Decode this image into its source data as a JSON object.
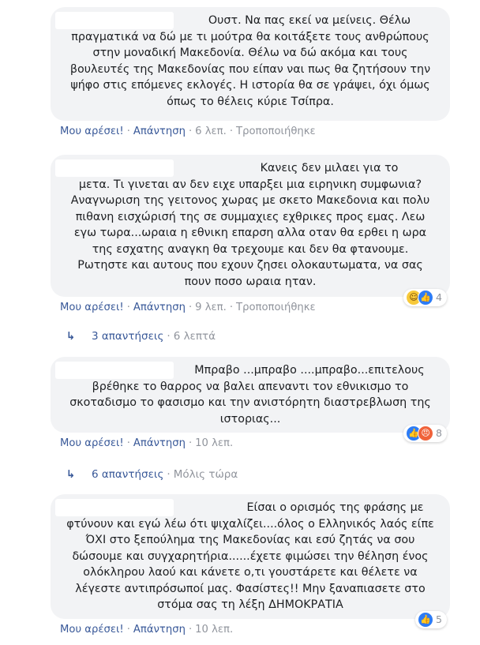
{
  "comments": [
    {
      "lines": [
        "Ουστ. Να πας εκεί να μείνεις. Θέλω",
        "πραγματικά να δώ με τι μούτρα θα κοιτάξετε τους ανθρώπους",
        "στην μοναδική Μακεδονία. Θέλω να δώ ακόμα και τους",
        "βουλευτές της Μακεδονίας που είπαν ναι πως θα ζητήσουν την",
        "ψήφο στις επόμενες εκλογές. Η ιστορία θα σε γράψει, όχι όμως",
        "όπως το θέλεις κύριε Τσίπρα."
      ],
      "like": "Μου αρέσει!",
      "reply": "Απάντηση",
      "time": "6 λεπ.",
      "edited": "Τροποποιήθηκε"
    },
    {
      "lines": [
        "Κανεις δεν μιλαει για το",
        "μετα. Τι γινεται αν δεν ειχε υπαρξει μια ειρηνικη συμφωνια?",
        "Αναγνωριση της γειτονος χωρας με σκετο Μακεδονια και πολυ",
        "πιθανη εισχώρισή της σε συμμαχιες εχθρικες προς εμας. Λεω",
        "εγω τωρα...ωραια η εθνικη επαρση αλλα οταν θα ερθει η ωρα",
        "της εσχατης αναγκη θα τρεχουμε και δεν θα φτανουμε.",
        "Ρωτηστε και αυτους που εχουν ζησει ολοκαυτωματα, να σας",
        "πουν ποσο ωραια ηταν."
      ],
      "like": "Μου αρέσει!",
      "reply": "Απάντηση",
      "time": "9 λεπ.",
      "edited": "Τροποποιήθηκε",
      "reaction_count": "4",
      "reaction_icons": [
        "haha-icon",
        "like-icon"
      ]
    },
    {
      "lines": [
        "Μπραβο ...μπραβο ....μπραβο...επιτελους",
        "βρέθηκε το θαρρος να βαλει απεναντι τον εθνικισμο το",
        "σκοταδισμο το φασισμο και την ανιστόρητη διαστρεβλωση της",
        "ιστοριας..."
      ],
      "like": "Μου αρέσει!",
      "reply": "Απάντηση",
      "time": "10 λεπ.",
      "reaction_count": "8",
      "reaction_icons": [
        "like-icon",
        "angry-icon"
      ]
    },
    {
      "lines": [
        "Είσαι ο ορισμός της φράσης με",
        "φτύνουν και εγώ λέω ότι ψιχαλίζει....όλος ο Ελληνικός λαός είπε",
        "ΌΧΙ στο ξεπούλημα της Μακεδονίας και εσύ ζητάς να σου",
        "δώσουμε και συγχαρητήρια......έχετε φιμώσει την θέληση ένος",
        "ολόκληρου λαού και κάνετε ο,τι γουστάρετε και θέλετε να",
        "λέγεστε αντιπρόσωποί μας. Φασίστες!! Μην ξαναπιασετε στο",
        "στόμα σας τη λέξη ΔΗΜΟΚΡΑΤΙΑ"
      ],
      "like": "Μου αρέσει!",
      "reply": "Απάντηση",
      "time": "10 λεπ.",
      "reaction_count": "5",
      "reaction_icons": [
        "like-icon"
      ]
    }
  ],
  "reply_threads": [
    {
      "label": "3 απαντήσεις",
      "time": "6 λεπτά"
    },
    {
      "label": "6 απαντήσεις",
      "time": "Μόλις τώρα"
    }
  ],
  "colors": {
    "link": "#385898",
    "muted": "#90949c",
    "bubble": "#f2f3f5",
    "like": "#2d7cf6"
  }
}
